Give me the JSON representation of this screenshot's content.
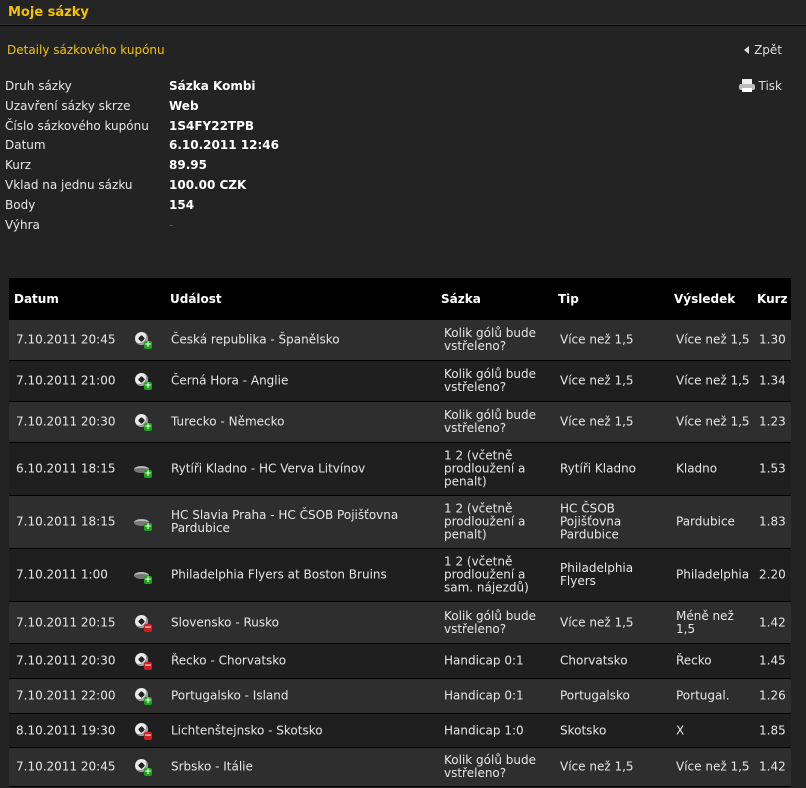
{
  "header": {
    "title": "Moje sázky"
  },
  "panel": {
    "subtitle": "Detaily sázkového kupónu",
    "back_label": "Zpět",
    "print_label": "Tisk"
  },
  "details": [
    {
      "label": "Druh sázky",
      "value": "Sázka Kombi"
    },
    {
      "label": "Uzavření sázky skrze",
      "value": "Web"
    },
    {
      "label": "Číslo sázkového kupónu",
      "value": "1S4FY22TPB"
    },
    {
      "label": "Datum",
      "value": "6.10.2011 12:46"
    },
    {
      "label": "Kurz",
      "value": "89.95"
    },
    {
      "label": "Vklad na jednu sázku",
      "value": "100.00 CZK"
    },
    {
      "label": "Body",
      "value": "154"
    },
    {
      "label": "Výhra",
      "value": "-"
    }
  ],
  "table": {
    "columns": {
      "date": "Datum",
      "event": "Událost",
      "bet": "Sázka",
      "tip": "Tip",
      "result": "Výsledek",
      "odds": "Kurz"
    },
    "rows": [
      {
        "date": "7.10.2011 20:45",
        "icon": "football-win-icon",
        "event": "Česká republika - Španělsko",
        "bet": "Kolik gólů bude vstřeleno?",
        "tip": "Více než 1,5",
        "result": "Více než 1,5",
        "odds": "1.30"
      },
      {
        "date": "7.10.2011 21:00",
        "icon": "football-win-icon",
        "event": "Černá Hora - Anglie",
        "bet": "Kolik gólů bude vstřeleno?",
        "tip": "Více než 1,5",
        "result": "Více než 1,5",
        "odds": "1.34"
      },
      {
        "date": "7.10.2011 20:30",
        "icon": "football-win-icon",
        "event": "Turecko - Německo",
        "bet": "Kolik gólů bude vstřeleno?",
        "tip": "Více než 1,5",
        "result": "Více než 1,5",
        "odds": "1.23"
      },
      {
        "date": "6.10.2011 18:15",
        "icon": "hockey-win-icon",
        "event": "Rytíři Kladno - HC Verva Litvínov",
        "bet": "1 2 (včetně prodloužení a penalt)",
        "tip": "Rytíři Kladno",
        "result": "Kladno",
        "odds": "1.53"
      },
      {
        "date": "7.10.2011 18:15",
        "icon": "hockey-win-icon",
        "event": "HC Slavia Praha - HC ČSOB Pojišťovna Pardubice",
        "bet": "1 2 (včetně prodloužení a penalt)",
        "tip": "HC ČSOB Pojišťovna Pardubice",
        "result": "Pardubice",
        "odds": "1.83"
      },
      {
        "date": "7.10.2011 1:00",
        "icon": "hockey-win-icon",
        "event": "Philadelphia Flyers at Boston Bruins",
        "bet": "1 2 (včetně prodloužení a sam. nájezdů)",
        "tip": "Philadelphia Flyers",
        "result": "Philadelphia",
        "odds": "2.20"
      },
      {
        "date": "7.10.2011 20:15",
        "icon": "football-loss-icon",
        "event": "Slovensko - Rusko",
        "bet": "Kolik gólů bude vstřeleno?",
        "tip": "Více než 1,5",
        "result": "Méně než 1,5",
        "odds": "1.42"
      },
      {
        "date": "7.10.2011 20:30",
        "icon": "football-loss-icon",
        "event": "Řecko - Chorvatsko",
        "bet": "Handicap 0:1",
        "tip": "Chorvatsko",
        "result": "Řecko",
        "odds": "1.45"
      },
      {
        "date": "7.10.2011 22:00",
        "icon": "football-win-icon",
        "event": "Portugalsko - Island",
        "bet": "Handicap 0:1",
        "tip": "Portugalsko",
        "result": "Portugal.",
        "odds": "1.26"
      },
      {
        "date": "8.10.2011 19:30",
        "icon": "football-loss-icon",
        "event": "Lichtenštejnsko - Skotsko",
        "bet": "Handicap 1:0",
        "tip": "Skotsko",
        "result": "X",
        "odds": "1.85"
      },
      {
        "date": "7.10.2011 20:45",
        "icon": "football-win-icon",
        "event": "Srbsko - Itálie",
        "bet": "Kolik gólů bude vstřeleno?",
        "tip": "Více než 1,5",
        "result": "Více než 1,5",
        "odds": "1.42"
      }
    ]
  },
  "colors": {
    "accent": "#f3c300",
    "win": "#1ea31e",
    "loss": "#d21e1e"
  }
}
